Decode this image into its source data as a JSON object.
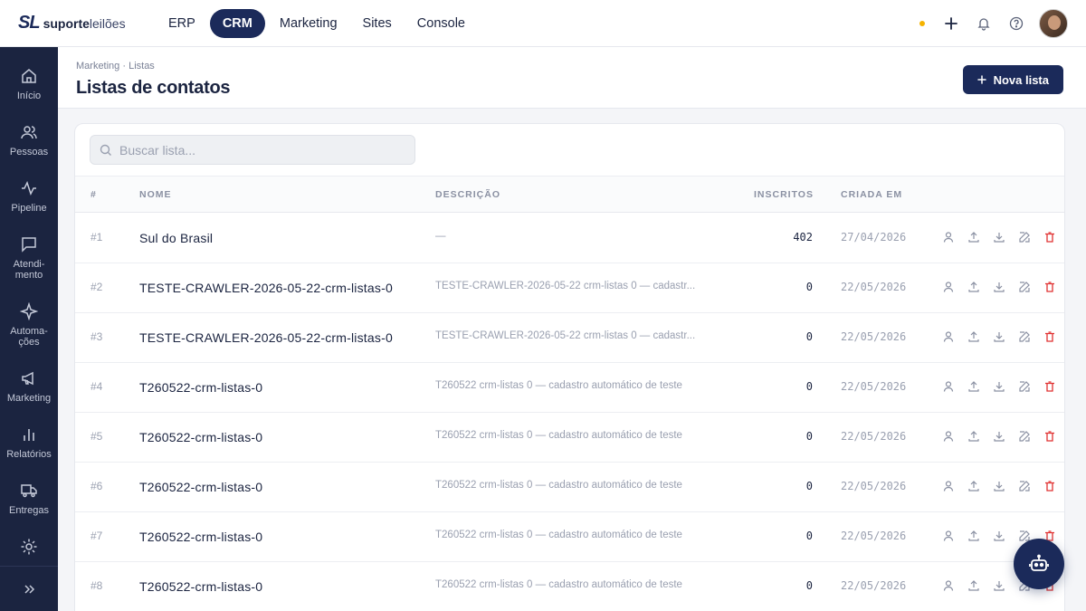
{
  "brand": {
    "mark": "SL",
    "word_bold": "suporte",
    "word_light": "leilões"
  },
  "topnav": [
    {
      "label": "ERP",
      "active": false
    },
    {
      "label": "CRM",
      "active": true
    },
    {
      "label": "Marketing",
      "active": false
    },
    {
      "label": "Sites",
      "active": false
    },
    {
      "label": "Console",
      "active": false
    }
  ],
  "topbar_icons": [
    "status-dot",
    "plus-icon",
    "bell-icon",
    "help-icon",
    "user-avatar"
  ],
  "sidebar": [
    {
      "label": "Início",
      "icon": "home-icon"
    },
    {
      "label": "Pessoas",
      "icon": "people-icon"
    },
    {
      "label": "Pipeline",
      "icon": "pipeline-icon"
    },
    {
      "label": "Atendi-\nmento",
      "icon": "chat-icon"
    },
    {
      "label": "Automa-\nções",
      "icon": "sparkle-icon"
    },
    {
      "label": "Marketing",
      "icon": "megaphone-icon"
    },
    {
      "label": "Relatórios",
      "icon": "bar-chart-icon"
    },
    {
      "label": "Entregas",
      "icon": "truck-icon"
    },
    {
      "label": "",
      "icon": "gear-icon"
    }
  ],
  "header": {
    "breadcrumb": "Marketing · Listas",
    "title": "Listas de contatos",
    "new_button": "Nova lista"
  },
  "search": {
    "placeholder": "Buscar lista..."
  },
  "table": {
    "columns": [
      "#",
      "NOME",
      "DESCRIÇÃO",
      "INSCRITOS",
      "CRIADA EM"
    ],
    "rows": [
      {
        "idx": "#1",
        "name": "Sul do Brasil",
        "desc": "—",
        "count": "402",
        "date": "27/04/2026"
      },
      {
        "idx": "#2",
        "name": "TESTE-CRAWLER-2026-05-22-crm-listas-0",
        "desc": "TESTE-CRAWLER-2026-05-22 crm-listas 0 — cadastr...",
        "count": "0",
        "date": "22/05/2026"
      },
      {
        "idx": "#3",
        "name": "TESTE-CRAWLER-2026-05-22-crm-listas-0",
        "desc": "TESTE-CRAWLER-2026-05-22 crm-listas 0 — cadastr...",
        "count": "0",
        "date": "22/05/2026"
      },
      {
        "idx": "#4",
        "name": "T260522-crm-listas-0",
        "desc": "T260522 crm-listas 0 — cadastro automático de teste",
        "count": "0",
        "date": "22/05/2026"
      },
      {
        "idx": "#5",
        "name": "T260522-crm-listas-0",
        "desc": "T260522 crm-listas 0 — cadastro automático de teste",
        "count": "0",
        "date": "22/05/2026"
      },
      {
        "idx": "#6",
        "name": "T260522-crm-listas-0",
        "desc": "T260522 crm-listas 0 — cadastro automático de teste",
        "count": "0",
        "date": "22/05/2026"
      },
      {
        "idx": "#7",
        "name": "T260522-crm-listas-0",
        "desc": "T260522 crm-listas 0 — cadastro automático de teste",
        "count": "0",
        "date": "22/05/2026"
      },
      {
        "idx": "#8",
        "name": "T260522-crm-listas-0",
        "desc": "T260522 crm-listas 0 — cadastro automático de teste",
        "count": "0",
        "date": "22/05/2026"
      }
    ],
    "row_actions": [
      "person-icon",
      "upload-icon",
      "download-icon",
      "edit-icon",
      "delete-icon"
    ]
  },
  "colors": {
    "primary": "#1b2a5a",
    "sidebar": "#1b2440",
    "danger": "#e03131",
    "status_dot": "#f5b300"
  },
  "fab": {
    "icon": "robot-icon"
  }
}
